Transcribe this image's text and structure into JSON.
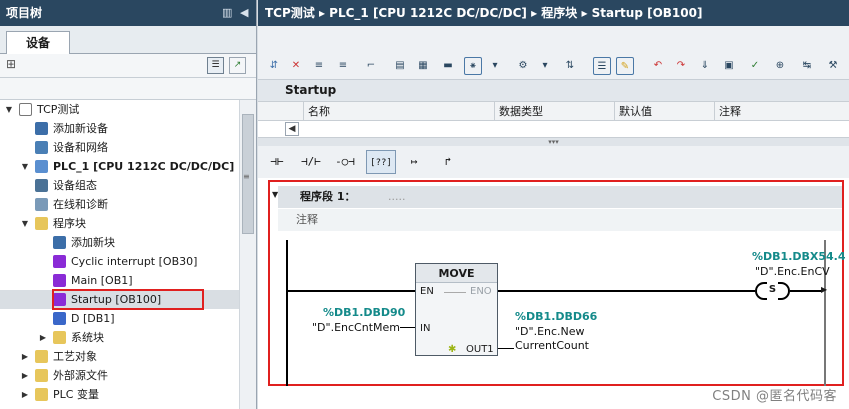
{
  "left_pane": {
    "title": "项目树",
    "title_controls": [
      "▥",
      "◀"
    ],
    "tab_label": "设备",
    "tree": [
      {
        "label": "TCP测试",
        "level": 0,
        "arrow": "▼",
        "icon": "project-icon",
        "icon_color": "#ffffff"
      },
      {
        "label": "添加新设备",
        "level": 1,
        "arrow": "",
        "icon": "add-device-icon",
        "icon_color": "#3c6ea8"
      },
      {
        "label": "设备和网络",
        "level": 1,
        "arrow": "",
        "icon": "network-icon",
        "icon_color": "#4a7fb5"
      },
      {
        "label": "PLC_1 [CPU 1212C DC/DC/DC]",
        "level": 1,
        "arrow": "▼",
        "icon": "plc-icon",
        "icon_color": "#5a8fd0",
        "bold": true
      },
      {
        "label": "设备组态",
        "level": 2,
        "arrow": "",
        "icon": "device-config-icon",
        "icon_color": "#4b7296"
      },
      {
        "label": "在线和诊断",
        "level": 2,
        "arrow": "",
        "icon": "diagnostics-icon",
        "icon_color": "#7a9ab8"
      },
      {
        "label": "程序块",
        "level": 2,
        "arrow": "▼",
        "icon": "folder-icon",
        "icon_color": "#e7c65b"
      },
      {
        "label": "添加新块",
        "level": 3,
        "arrow": "",
        "icon": "add-block-icon",
        "icon_color": "#3c6ea8"
      },
      {
        "label": "Cyclic interrupt [OB30]",
        "level": 3,
        "arrow": "",
        "icon": "ob-block-icon",
        "icon_color": "#8a2bd6"
      },
      {
        "label": "Main [OB1]",
        "level": 3,
        "arrow": "",
        "icon": "ob-block-icon",
        "icon_color": "#8a2bd6"
      },
      {
        "label": "Startup [OB100]",
        "level": 3,
        "arrow": "",
        "icon": "ob-block-icon",
        "icon_color": "#8a2bd6",
        "selected": true
      },
      {
        "label": "D [DB1]",
        "level": 3,
        "arrow": "",
        "icon": "db-block-icon",
        "icon_color": "#3a67c9"
      },
      {
        "label": "系统块",
        "level": 3,
        "arrow": "▶",
        "icon": "folder-icon",
        "icon_color": "#e7c65b"
      },
      {
        "label": "工艺对象",
        "level": 2,
        "arrow": "▶",
        "icon": "folder-icon",
        "icon_color": "#e7c65b"
      },
      {
        "label": "外部源文件",
        "level": 2,
        "arrow": "▶",
        "icon": "folder-icon",
        "icon_color": "#e7c65b"
      },
      {
        "label": "PLC 变量",
        "level": 2,
        "arrow": "▶",
        "icon": "folder-icon",
        "icon_color": "#e7c65b"
      }
    ]
  },
  "editor": {
    "breadcrumb": "TCP测试 ▸ PLC_1 [CPU 1212C DC/DC/DC] ▸ 程序块 ▸ Startup [OB100]",
    "block_name": "Startup",
    "interface_columns": [
      "名称",
      "数据类型",
      "默认值",
      "注释"
    ],
    "ladder_toolbar": [
      "⊣⊢",
      "⊣/⊢",
      "-○⊣",
      "[??]",
      "↦",
      "↱"
    ],
    "network": {
      "title": "程序段 1：",
      "title_placeholder": ".....",
      "comment": "注释",
      "instruction": "MOVE",
      "pins": {
        "en": "EN",
        "eno": "ENO",
        "in": "IN",
        "out": "OUT1",
        "out_marker": "✱"
      },
      "in_address": "%DB1.DBD90",
      "in_symbol": "\"D\".EncCntMem",
      "out_address": "%DB1.DBD66",
      "out_symbol_1": "\"D\".Enc.New",
      "out_symbol_2": "CurrentCount",
      "coil_address": "%DB1.DBX54.4",
      "coil_symbol": "\"D\".Enc.EnCV",
      "coil_type": "S"
    }
  },
  "watermark": "CSDN @匿名代码客"
}
